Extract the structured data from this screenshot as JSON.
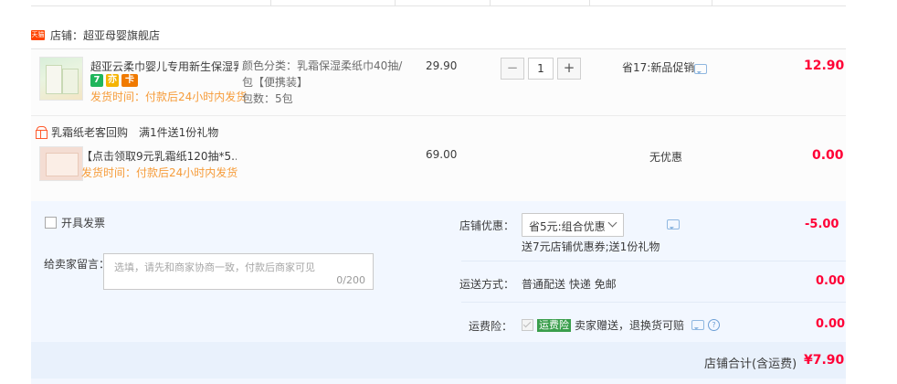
{
  "shop": {
    "logo_text": "天猫",
    "label": "店铺：超亚母婴旗舰店"
  },
  "items": [
    {
      "title": "超亚云柔巾婴儿专用新生保湿乳...",
      "badges": [
        "7",
        "亦",
        "卡"
      ],
      "ship_time": "发货时间：付款后24小时内发货",
      "spec_line1": "颜色分类：乳霜保湿柔纸巾40抽/",
      "spec_line2": "包【便携装】",
      "spec_line3": "包数：5包",
      "price": "29.90",
      "quantity": "1",
      "qty_minus": "−",
      "qty_plus": "+",
      "promo": "省17:新品促销",
      "total": "12.90"
    },
    {
      "title": "【点击领取9元乳霜纸120抽*5...",
      "ship_time": "发货时间：付款后24小时内发货",
      "price": "69.00",
      "promo": "无优惠",
      "total": "0.00"
    }
  ],
  "gift": {
    "title": "乳霜纸老客回购",
    "rule": "满1件送1份礼物"
  },
  "invoice": {
    "label": "开具发票"
  },
  "message": {
    "label": "给卖家留言：",
    "placeholder": "选填，请先和商家协商一致，付款后商家可见",
    "counter": "0/200"
  },
  "shop_discount": {
    "label": "店铺优惠：",
    "selected": "省5元:组合优惠",
    "note": "送7元店铺优惠券;送1份礼物",
    "amount": "-5.00"
  },
  "shipping": {
    "label": "运送方式：",
    "value": "普通配送 快递 免邮",
    "amount": "0.00"
  },
  "insurance": {
    "label": "运费险：",
    "badge": "运费险",
    "text": "卖家赠送，退换货可赔",
    "help": "?",
    "amount": "0.00"
  },
  "summary": {
    "label": "店铺合计(含运费)",
    "amount": "¥7.90"
  },
  "colors": {
    "accent_red": "#ff0036",
    "ship_orange": "#f69c3a",
    "panel_blue": "#f2f7ff",
    "tmall_red": "#ff4400"
  }
}
